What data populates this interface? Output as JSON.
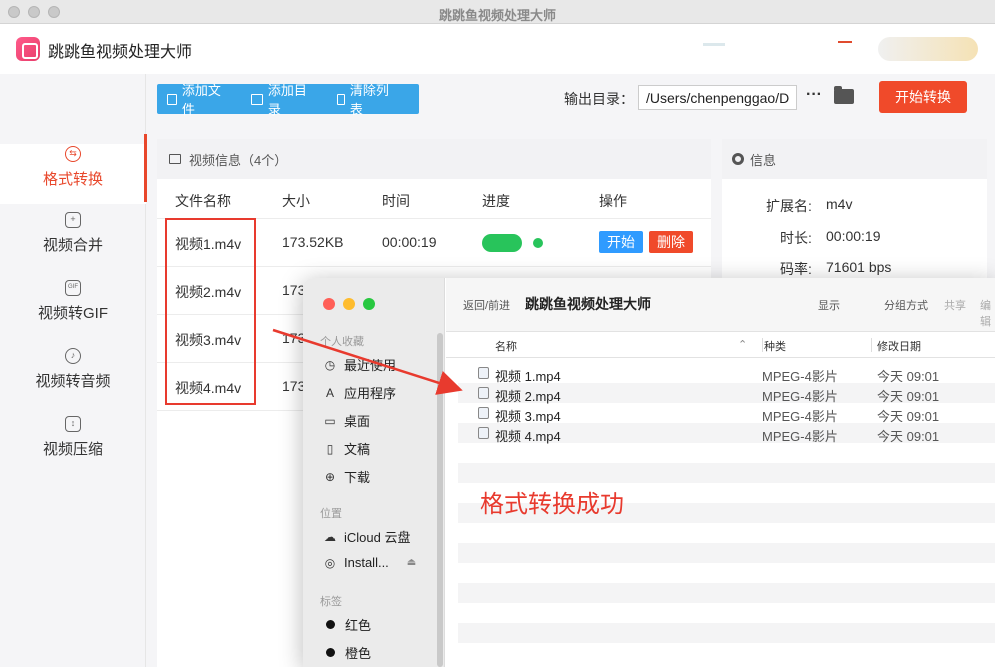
{
  "window": {
    "title": "跳跳鱼视频处理大师"
  },
  "app": {
    "name": "跳跳鱼视频处理大师"
  },
  "sidebar": {
    "items": [
      {
        "label": "格式转换",
        "icon": "convert-icon",
        "active": true
      },
      {
        "label": "视频合并",
        "icon": "merge-icon"
      },
      {
        "label": "视频转GIF",
        "icon": "gif-icon"
      },
      {
        "label": "视频转音频",
        "icon": "audio-icon"
      },
      {
        "label": "视频压缩",
        "icon": "compress-icon"
      }
    ]
  },
  "toolbar": {
    "add_file": "添加文件",
    "add_dir": "添加目录",
    "clear_list": "清除列表",
    "output_label": "输出目录：",
    "output_path": "/Users/chenpenggao/D",
    "more": "···",
    "start_all": "开始转换"
  },
  "file_panel": {
    "title": "视频信息（4个）",
    "columns": [
      "文件名称",
      "大小",
      "时间",
      "进度",
      "操作"
    ],
    "rows": [
      {
        "name": "视频1.m4v",
        "size": "173.52KB",
        "time": "00:00:19",
        "progress": 1.0,
        "start": "开始",
        "delete": "删除"
      },
      {
        "name": "视频2.m4v",
        "size": "173"
      },
      {
        "name": "视频3.m4v",
        "size": "173"
      },
      {
        "name": "视频4.m4v",
        "size": "173"
      }
    ]
  },
  "info_panel": {
    "title": "信息",
    "ext_label": "扩展名:",
    "ext_value": "m4v",
    "dur_label": "时长:",
    "dur_value": "00:00:19",
    "rate_label": "码率:",
    "rate_value": "71601 bps"
  },
  "finder": {
    "nav": "返回/前进",
    "title": "跳跳鱼视频处理大师",
    "tools": {
      "show": "显示",
      "group": "分组方式",
      "share": "共享",
      "edit": "编辑"
    },
    "sections": {
      "favorites": "个人收藏",
      "locations": "位置",
      "tags": "标签"
    },
    "favorites": [
      {
        "label": "最近使用",
        "icon": "clock-icon"
      },
      {
        "label": "应用程序",
        "icon": "apps-icon"
      },
      {
        "label": "桌面",
        "icon": "desktop-icon"
      },
      {
        "label": "文稿",
        "icon": "document-icon"
      },
      {
        "label": "下载",
        "icon": "download-icon"
      }
    ],
    "locations": [
      {
        "label": "iCloud 云盘",
        "icon": "cloud-icon"
      },
      {
        "label": "Install...",
        "icon": "disk-icon"
      }
    ],
    "tags": [
      {
        "label": "红色"
      },
      {
        "label": "橙色"
      }
    ],
    "columns": {
      "name": "名称",
      "kind": "种类",
      "date": "修改日期"
    },
    "files": [
      {
        "name": "视频 1.mp4",
        "kind": "MPEG-4影片",
        "date": "今天 09:01"
      },
      {
        "name": "视频 2.mp4",
        "kind": "MPEG-4影片",
        "date": "今天 09:01"
      },
      {
        "name": "视频 3.mp4",
        "kind": "MPEG-4影片",
        "date": "今天 09:01"
      },
      {
        "name": "视频 4.mp4",
        "kind": "MPEG-4影片",
        "date": "今天 09:01"
      }
    ]
  },
  "annotation": {
    "text": "格式转换成功",
    "color": "#e83a2e"
  },
  "colors": {
    "accent": "#f04a2a",
    "toolbar": "#3aa6e8",
    "progress": "#28c45b",
    "start_btn": "#2f9bff"
  }
}
